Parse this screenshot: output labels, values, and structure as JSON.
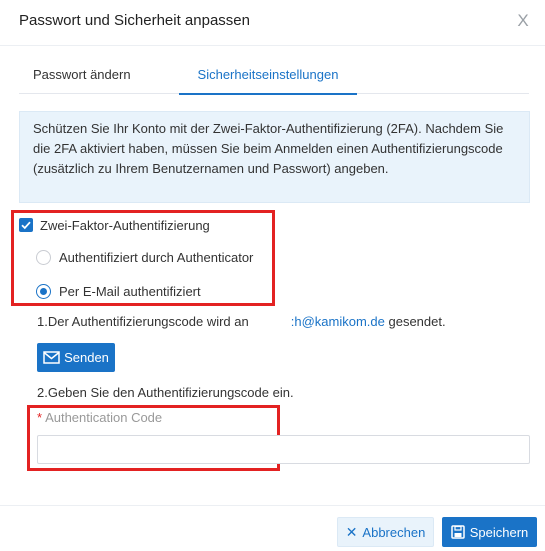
{
  "dialog": {
    "title": "Passwort und Sicherheit anpassen",
    "close_glyph": "X"
  },
  "tabs": [
    {
      "label": "Passwort ändern",
      "active": false
    },
    {
      "label": "Sicherheitseinstellungen",
      "active": true
    }
  ],
  "info": {
    "text": "Schützen Sie Ihr Konto mit der Zwei-Faktor-Authentifizierung (2FA). Nachdem Sie die 2FA aktiviert haben, müssen Sie beim Anmelden einen Authentifizierungscode (zusätzlich zu Ihrem Benutzernamen und Passwort) angeben."
  },
  "twofa": {
    "checkbox_label": "Zwei-Faktor-Authentifizierung",
    "checked": true,
    "options": [
      {
        "label": "Authentifiziert durch Authenticator",
        "selected": false
      },
      {
        "label": "Per E-Mail authentifiziert",
        "selected": true
      }
    ]
  },
  "step1": {
    "prefix": "1.Der Authentifizierungscode wird an",
    "email": ":h@kamikom.de",
    "suffix": "gesendet."
  },
  "send_button": {
    "label": "Senden",
    "icon": "mail-icon"
  },
  "step2": {
    "text": "2.Geben Sie den Authentifizierungscode ein."
  },
  "code_field": {
    "required_mark": "*",
    "label": "Authentication Code",
    "value": ""
  },
  "footer": {
    "cancel_label": "Abbrechen",
    "cancel_glyph": "✕",
    "save_label": "Speichern"
  },
  "colors": {
    "accent": "#1a73c7",
    "info_bg": "#e9f3fb",
    "highlight": "#e32222"
  }
}
